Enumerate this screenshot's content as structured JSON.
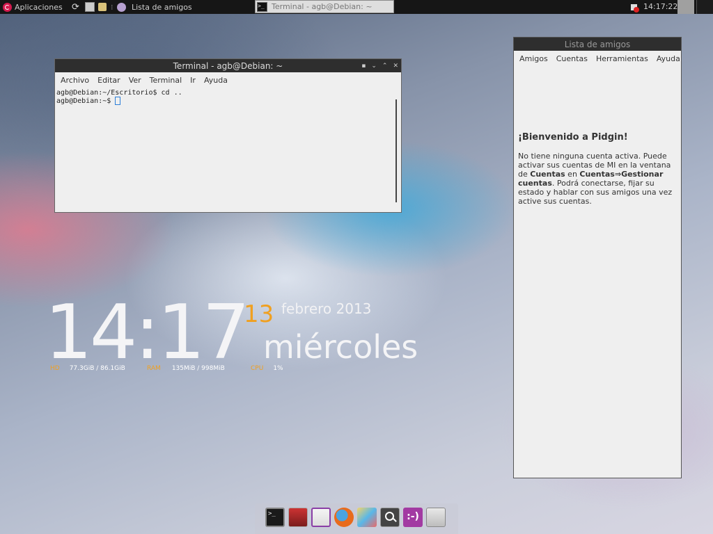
{
  "top_panel": {
    "apps_label": "Aplicaciones",
    "active_window_label": "Lista de amigos",
    "task_terminal_title": "Terminal - agb@Debian: ~",
    "clock": "14:17:22"
  },
  "terminal": {
    "title": "Terminal - agb@Debian: ~",
    "menu": [
      "Archivo",
      "Editar",
      "Ver",
      "Terminal",
      "Ir",
      "Ayuda"
    ],
    "lines": [
      "agb@Debian:~/Escritorio$ cd ..",
      "agb@Debian:~$ "
    ]
  },
  "pidgin": {
    "title": "Lista de amigos",
    "menu": [
      "Amigos",
      "Cuentas",
      "Herramientas",
      "Ayuda"
    ],
    "welcome": "¡Bienvenido a Pidgin!",
    "body": {
      "p1": "No tiene ninguna cuenta activa. Puede activar sus cuentas de MI en la ventana de ",
      "b1": "Cuentas",
      "p2": " en ",
      "b2": "Cuentas⇒Gestionar cuentas",
      "p3": ". Podrá conectarse, fijar su estado y hablar con sus amigos una vez active sus cuentas."
    }
  },
  "desktop_clock": {
    "time": "14:17",
    "day": "13",
    "month_year": "febrero 2013",
    "weekday": "miércoles",
    "stats": {
      "hd_label": "HD",
      "hd_value": "77.3GiB / 86.1GiB",
      "ram_label": "RAM",
      "ram_value": "135MiB / 998MiB",
      "cpu_label": "CPU",
      "cpu_value": "1%"
    }
  },
  "dock": {
    "items": [
      "terminal-icon",
      "software-center-icon",
      "writer-icon",
      "firefox-icon",
      "paint-icon",
      "search-icon",
      "pidgin-icon",
      "mixer-icon"
    ]
  },
  "colors": {
    "panel_bg": "#161616",
    "accent_orange": "#f0a020",
    "window_bg": "#efefef",
    "titlebar_bg": "#2e2e2e"
  }
}
